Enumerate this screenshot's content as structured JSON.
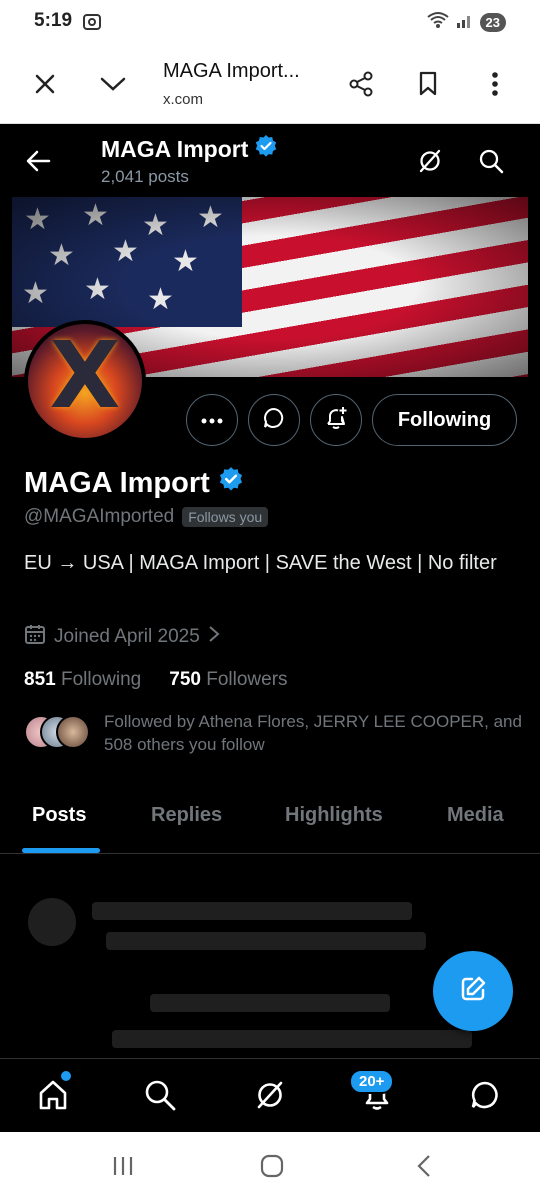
{
  "status_bar": {
    "time": "5:19",
    "battery": "23",
    "icons": [
      "screenshot-icon",
      "wifi-icon",
      "signal-icon"
    ]
  },
  "browser": {
    "page_title": "MAGA Import...",
    "url": "x.com",
    "icons": [
      "close-icon",
      "chevron-down-icon",
      "share-icon",
      "bookmark-icon",
      "more-vertical-icon"
    ]
  },
  "header": {
    "name": "MAGA Import",
    "posts_count": "2,041 posts",
    "icons": [
      "back-arrow-icon",
      "grok-icon",
      "search-icon"
    ]
  },
  "profile": {
    "name": "MAGA Import",
    "handle": "@MAGAImported",
    "follows_you": "Follows you",
    "bio": "EU → USA | MAGA Import | SAVE the West | No filter",
    "joined": "Joined April 2025",
    "following_count": "851",
    "following_label": "Following",
    "followers_count": "750",
    "followers_label": "Followers",
    "followed_by": "Followed by Athena Flores, JERRY LEE COOPER, and 508 others you follow"
  },
  "actions": {
    "following_button": "Following",
    "icons": [
      "more-icon",
      "message-icon",
      "notify-plus-icon"
    ]
  },
  "tabs": [
    {
      "label": "Posts",
      "active": true
    },
    {
      "label": "Replies",
      "active": false
    },
    {
      "label": "Highlights",
      "active": false
    },
    {
      "label": "Media",
      "active": false
    }
  ],
  "bottom_nav": {
    "items": [
      "home-icon",
      "search-icon",
      "grok-icon",
      "notifications-icon",
      "messages-icon"
    ],
    "notification_badge": "20+"
  },
  "colors": {
    "accent": "#1d9bf0",
    "background": "#000000",
    "muted_text": "#71767b"
  }
}
